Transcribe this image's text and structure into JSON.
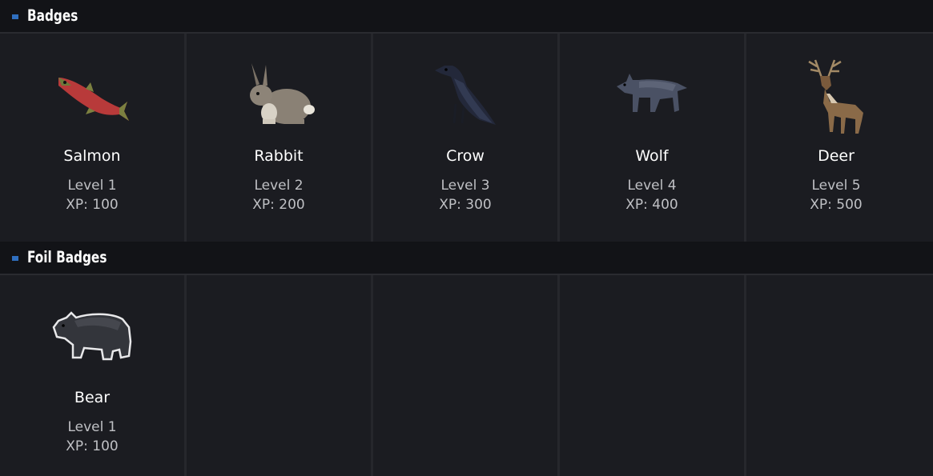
{
  "sections": [
    {
      "title": "Badges",
      "badges": [
        {
          "name": "Salmon",
          "level": "Level 1",
          "xp": "XP: 100",
          "icon": "salmon-icon"
        },
        {
          "name": "Rabbit",
          "level": "Level 2",
          "xp": "XP: 200",
          "icon": "rabbit-icon"
        },
        {
          "name": "Crow",
          "level": "Level 3",
          "xp": "XP: 300",
          "icon": "crow-icon"
        },
        {
          "name": "Wolf",
          "level": "Level 4",
          "xp": "XP: 400",
          "icon": "wolf-icon"
        },
        {
          "name": "Deer",
          "level": "Level 5",
          "xp": "XP: 500",
          "icon": "deer-icon"
        }
      ]
    },
    {
      "title": "Foil Badges",
      "badges": [
        {
          "name": "Bear",
          "level": "Level 1",
          "xp": "XP: 100",
          "icon": "bear-icon"
        }
      ]
    }
  ],
  "colors": {
    "background": "#1b1c21",
    "header_background": "#121317",
    "accent": "#2f6fbf"
  }
}
